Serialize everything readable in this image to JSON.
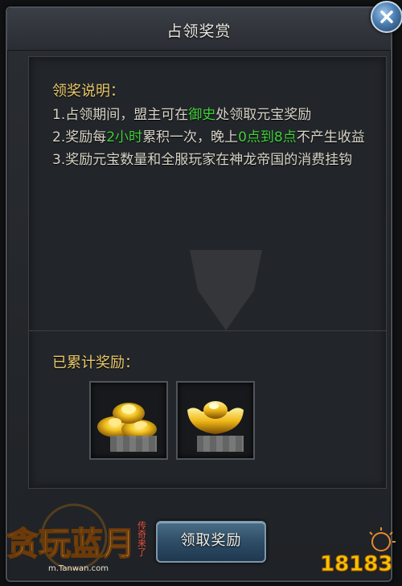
{
  "dialog": {
    "title": "占领奖赏"
  },
  "rules": {
    "heading": "领奖说明：",
    "line1": {
      "prefix": "1.占领期间，盟主可在",
      "highlight": "御史",
      "suffix": "处领取元宝奖励"
    },
    "line2": {
      "prefix": "2.奖励每",
      "highlight1": "2小时",
      "middle": "累积一次，晚上",
      "highlight2": "0点到8点",
      "suffix": "不产生收益"
    },
    "line3": "3.奖励元宝数量和全服玩家在神龙帝国的消费挂钩"
  },
  "accumulated": {
    "heading": "已累计奖励：",
    "items": [
      {
        "icon": "gold-ingot-pile-icon"
      },
      {
        "icon": "gold-ingot-icon"
      }
    ]
  },
  "actions": {
    "claim_label": "领取奖励"
  },
  "branding": {
    "logo_text": "贪玩蓝月",
    "logo_sub": "传奇来了",
    "logo_url": "m.Tanwan.com",
    "site_badge": "18183"
  },
  "colors": {
    "heading": "#e8c868",
    "highlight": "#3fd13b",
    "body_text": "#d8d4c8"
  }
}
